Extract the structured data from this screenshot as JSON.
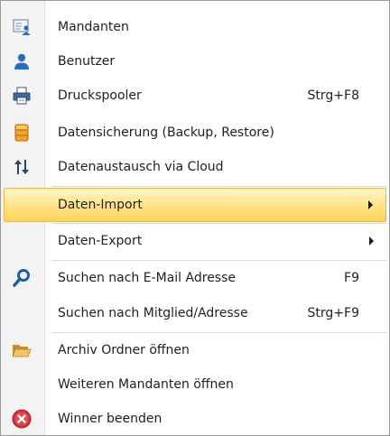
{
  "menu": {
    "items": [
      {
        "label": "Mandanten",
        "shortcut": "",
        "icon": "clients-list-icon"
      },
      {
        "label": "Benutzer",
        "shortcut": "",
        "icon": "user-icon"
      },
      {
        "label": "Druckspooler",
        "shortcut": "Strg+F8",
        "icon": "printer-icon"
      },
      {
        "label": "Datensicherung (Backup, Restore)",
        "shortcut": "",
        "icon": "database-icon"
      },
      {
        "label": "Datenaustausch via Cloud",
        "shortcut": "",
        "icon": "up-down-arrows-icon"
      },
      {
        "label": "Daten-Import",
        "shortcut": "",
        "icon": "",
        "submenu": true,
        "highlighted": true
      },
      {
        "label": "Daten-Export",
        "shortcut": "",
        "icon": "",
        "submenu": true
      },
      {
        "label": "Suchen nach E-Mail Adresse",
        "shortcut": "F9",
        "icon": "search-icon"
      },
      {
        "label": "Suchen nach Mitglied/Adresse",
        "shortcut": "Strg+F9",
        "icon": ""
      },
      {
        "label": "Archiv Ordner öffnen",
        "shortcut": "",
        "icon": "folder-open-icon"
      },
      {
        "label": "Weiteren Mandanten öffnen",
        "shortcut": "",
        "icon": ""
      },
      {
        "label": "Winner beenden",
        "shortcut": "",
        "icon": "exit-icon"
      }
    ]
  },
  "colors": {
    "highlight_top": "#fff7cc",
    "highlight_bottom": "#ffd45a",
    "highlight_border": "#e8b94a",
    "gutter": "#f3f3f3"
  }
}
